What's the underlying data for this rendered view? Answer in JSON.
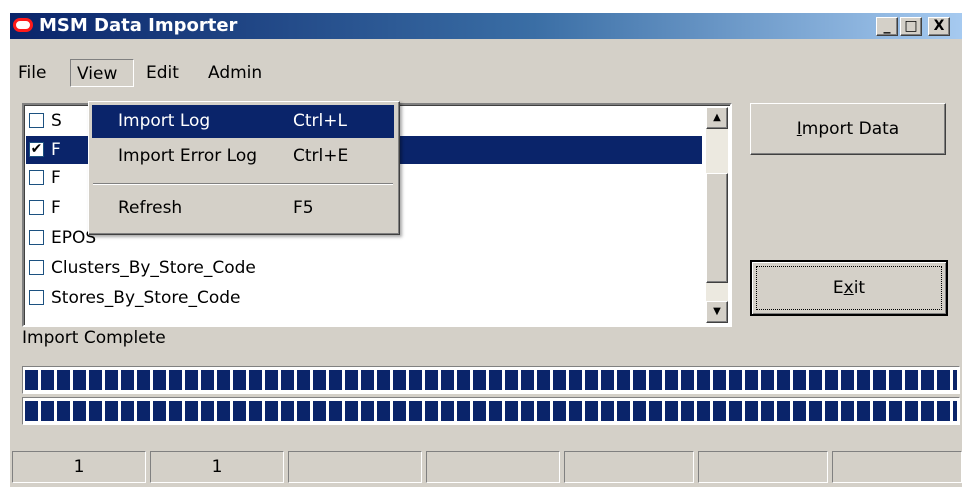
{
  "window": {
    "title": "MSM Data Importer"
  },
  "title_buttons": {
    "minimize": "_",
    "maximize": "□",
    "close": "X"
  },
  "menubar": {
    "items": [
      "File",
      "View",
      "Edit",
      "Admin"
    ]
  },
  "list": {
    "rows": [
      {
        "label": "S",
        "checked": false,
        "selected": false
      },
      {
        "label": "F",
        "checked": true,
        "selected": true
      },
      {
        "label": "F",
        "checked": false,
        "selected": false
      },
      {
        "label": "F",
        "checked": false,
        "selected": false
      },
      {
        "label": "EPOS",
        "checked": false,
        "selected": false
      },
      {
        "label": "Clusters_By_Store_Code",
        "checked": false,
        "selected": false
      },
      {
        "label": "Stores_By_Store_Code",
        "checked": false,
        "selected": false
      }
    ]
  },
  "view_menu": {
    "items": [
      {
        "label": "Import Log",
        "shortcut": "Ctrl+L",
        "highlighted": true
      },
      {
        "label": "Import Error Log",
        "shortcut": "Ctrl+E",
        "highlighted": false
      },
      {
        "label": "Refresh",
        "shortcut": "F5",
        "highlighted": false
      }
    ]
  },
  "buttons": {
    "import_prefix": "",
    "import_mnemonic": "I",
    "import_rest": "mport Data",
    "exit_prefix": "E",
    "exit_mnemonic": "x",
    "exit_rest": "it"
  },
  "status": {
    "text": "Import Complete"
  },
  "progress": {
    "bar1_fraction": 1.0,
    "bar2_fraction": 1.0
  },
  "statusbar": {
    "panels": [
      "1",
      "1",
      "",
      "",
      "",
      "",
      ""
    ]
  },
  "colors": {
    "title_start": "#0a246a",
    "title_end": "#a6caf0",
    "selection": "#0a246a",
    "face": "#d4d0c8",
    "icon_red": "#ff1a1a"
  }
}
